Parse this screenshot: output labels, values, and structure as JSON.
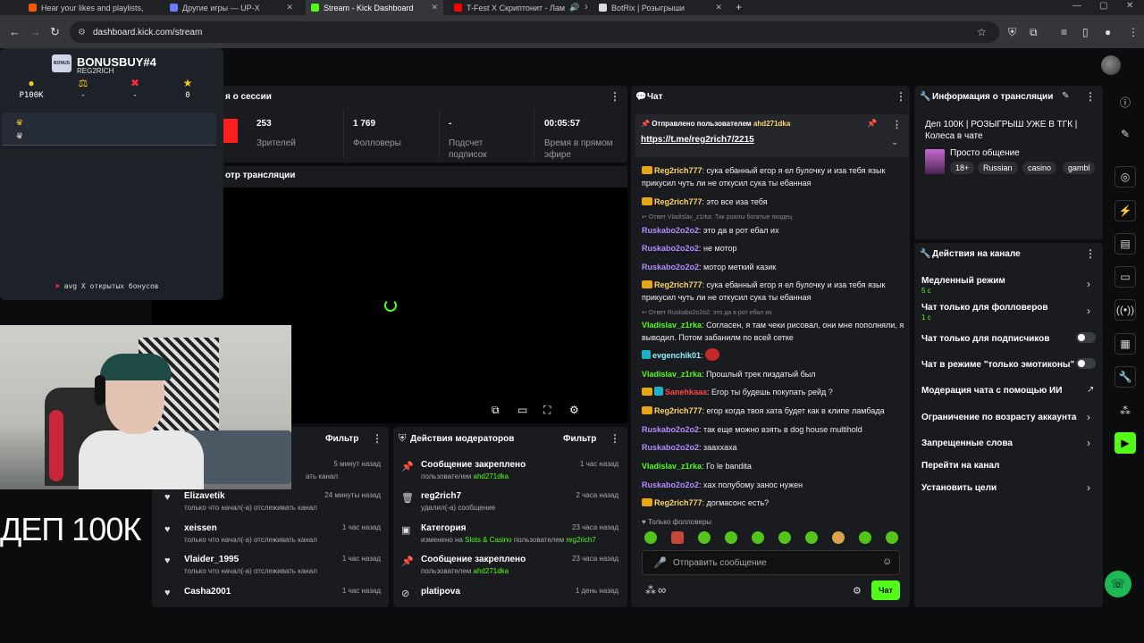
{
  "browser": {
    "tabs": [
      {
        "title": "Hear your likes and playlists, an",
        "color": "#ff5500",
        "active": false
      },
      {
        "title": "Другие игры — UP-X",
        "color": "#6a7bff",
        "active": false
      },
      {
        "title": "Stream - Kick Dashboard",
        "color": "#53fc18",
        "active": true
      },
      {
        "title": "T-Fest X Скриптонит - Лам",
        "color": "#ff0000",
        "active": false
      },
      {
        "title": "BotRix | Розыгрыши",
        "color": "#dddddd",
        "active": false
      }
    ],
    "url": "dashboard.kick.com/stream"
  },
  "bonus_overlay": {
    "title": "BONUSBUY#4",
    "subtitle": "REG2RICH",
    "logo_text": "BONUS",
    "stats": [
      {
        "icon": "coin-icon",
        "value": "Р100К"
      },
      {
        "icon": "scales-icon",
        "value": "-"
      },
      {
        "icon": "cross-icon",
        "value": "-"
      },
      {
        "icon": "star-icon",
        "value": "0"
      }
    ],
    "rows": [
      "-",
      "-"
    ],
    "footer": "avg X открытых бонусов"
  },
  "caption": "ДЕП 100К",
  "session": {
    "title": "я о сессии",
    "stats": [
      {
        "value": "253",
        "label": "Зрителей"
      },
      {
        "value": "1 769",
        "label": "Фолловеры"
      },
      {
        "value": "-",
        "label": "Подсчет подписок"
      },
      {
        "value": "00:05:57",
        "label": "Время в прямом эфире"
      }
    ]
  },
  "preview": {
    "title": "отр трансляции"
  },
  "activity": {
    "filter": "Фильтр",
    "items": [
      {
        "name": "",
        "sub": "",
        "time": "5 минут назад"
      },
      {
        "name": "Elizavetik",
        "sub": "только что начал(-а) отслеживать канал",
        "time": "24 минуты назад"
      },
      {
        "name": "xeissen",
        "sub": "только что начал(-а) отслеживать канал",
        "time": "1 час назад"
      },
      {
        "name": "Vlaider_1995",
        "sub": "только что начал(-а) отслеживать канал",
        "time": "1 час назад"
      },
      {
        "name": "Casha2001",
        "sub": "",
        "time": "1 час назад"
      }
    ],
    "partial_sub": "ать канал"
  },
  "mod_actions": {
    "title": "Действия модераторов",
    "filter": "Фильтр",
    "items": [
      {
        "icon": "pin-icon",
        "name": "Сообщение закреплено",
        "sub_prefix": "пользователем",
        "sub_user": "ahd271dka",
        "sub_mid": "",
        "time": "1 час назад"
      },
      {
        "icon": "trash-icon",
        "name": "reg2rich7",
        "sub_prefix": "удалил(-а) сообщение",
        "sub_user": "",
        "sub_mid": "",
        "time": "2 часа назад"
      },
      {
        "icon": "category-icon",
        "name": "Категория",
        "sub_prefix": "изменено на",
        "sub_user": "Slots & Casino",
        "sub_mid": "пользователем",
        "sub_user2": "reg2rich7",
        "time": "23 часа назад"
      },
      {
        "icon": "pin-icon",
        "name": "Сообщение закреплено",
        "sub_prefix": "пользователем",
        "sub_user": "ahd271dka",
        "sub_mid": "",
        "time": "23 часа назад"
      },
      {
        "icon": "ban-icon",
        "name": "platipova",
        "sub_prefix": "",
        "sub_user": "",
        "sub_mid": "",
        "time": "1 день назад"
      }
    ]
  },
  "chat": {
    "title": "Чат",
    "pinned_by_label": "Отправлено пользователем",
    "pinned_by_user": "ahd271dka",
    "pinned_link": "https://t.me/reg2rich7/2215",
    "messages": [
      {
        "user": "Reg2rich777",
        "color": "orange",
        "badge": true,
        "text": "сука ебанный егор я ел булочку и иза тебя язык прикусил чуть ли не откусил сука ты ебанная"
      },
      {
        "user": "Reg2rich777",
        "color": "orange",
        "badge": true,
        "text": "это все иза тебя"
      },
      {
        "reply": "↩ Ответ Vladislav_z1rka: Так роялы богатые пиздец"
      },
      {
        "user": "Ruskabo2o2o2",
        "color": "purple",
        "text": "это да в рот ебал их"
      },
      {
        "user": "Ruskabo2o2o2",
        "color": "purple",
        "text": "не мотор"
      },
      {
        "user": "Ruskabo2o2o2",
        "color": "purple",
        "text": "мотор меткий казик"
      },
      {
        "user": "Reg2rich777",
        "color": "orange",
        "badge": true,
        "text": "сука ебанный егор я ел булочку и иза тебя язык прикусил чуть ли не откусил сука ты ебанная"
      },
      {
        "reply": "↩ Ответ Ruskabo2o2o2: это да в рот ебал их"
      },
      {
        "user": "Vladislav_z1rka",
        "color": "green",
        "text": "Согласен, я там чеки рисовал, они мне пополняли, я выводил. Потом забанилм по всей сетке"
      },
      {
        "user": "evgenchik01",
        "color": "teal",
        "badge2": true,
        "text": ""
      },
      {
        "user": "Vladislav_z1rka",
        "color": "green",
        "text": "Прошлый трек пиздатый был"
      },
      {
        "user": "Sanehkaaa",
        "color": "red",
        "badge": true,
        "badge2": true,
        "text": "Егор ты будешь покупать рейд ?"
      },
      {
        "user": "Reg2rich777",
        "color": "orange",
        "badge": true,
        "text": "егор когда твоя хата будет как в клипе ламбада"
      },
      {
        "user": "Ruskabo2o2o2",
        "color": "purple",
        "text": "так еще можно взять в dog house multihold"
      },
      {
        "user": "Ruskabo2o2o2",
        "color": "purple",
        "text": "зааххаха"
      },
      {
        "user": "Vladislav_z1rka",
        "color": "green",
        "text": "Го le bandita"
      },
      {
        "user": "Ruskabo2o2o2",
        "color": "purple",
        "text": "хах полубому занос нужен"
      },
      {
        "user": "Reg2rich777",
        "color": "orange",
        "badge": true,
        "text": "догмасонс есть?"
      }
    ],
    "followers_only": "♥ Только фолловеры",
    "placeholder": "Отправить сообщение",
    "send_label": "Чат"
  },
  "stream_info": {
    "title": "Информация о трансляции",
    "stream_title": "Деп 100К | РОЗЫГРЫШ УЖЕ В ТГК | Колеса в чате",
    "category": "Просто общение",
    "tags": [
      "18+",
      "Russian",
      "casino",
      "gambl"
    ]
  },
  "channel_actions": {
    "title": "Действия на канале",
    "items": [
      {
        "label": "Медленный режим",
        "sub": "5 с",
        "control": "chevron"
      },
      {
        "label": "Чат только для фолловеров",
        "sub": "1 с",
        "control": "chevron"
      },
      {
        "label": "Чат только для подписчиков",
        "sub": "",
        "control": "toggle"
      },
      {
        "label": "Чат в режиме \"только эмотиконы\"",
        "sub": "",
        "control": "toggle"
      },
      {
        "label": "Модерация чата с помощью ИИ",
        "sub": "",
        "control": "external"
      },
      {
        "label": "Ограничение по возрасту аккаунта",
        "sub": "",
        "control": "chevron"
      },
      {
        "label": "Запрещенные слова",
        "sub": "",
        "control": "chevron"
      },
      {
        "label": "Перейти на канал",
        "sub": "",
        "control": "none"
      },
      {
        "label": "Установить цели",
        "sub": "",
        "control": "chevron"
      }
    ]
  },
  "colors": {
    "accent": "#53fc18",
    "panel": "#191b1f",
    "background": "#0b0c0e"
  }
}
